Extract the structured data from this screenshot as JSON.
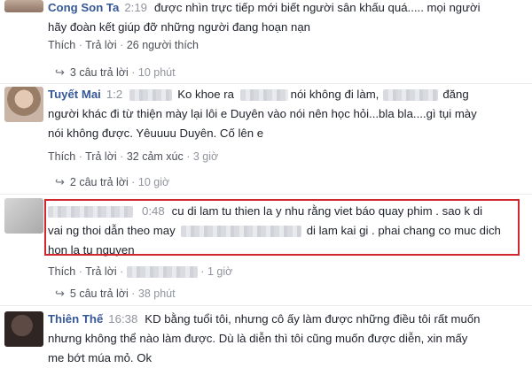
{
  "comments": [
    {
      "name": "Cong Son Ta",
      "time": "2:19",
      "text_line1": "được nhìn trực tiếp mới biết người sân khấu quá..... mọi người",
      "text_line2": "hãy đoàn kết giúp đỡ những người đang hoạn nạn",
      "action_like": "Thích",
      "action_reply": "Trả lời",
      "reaction": "26 người thích",
      "replies_count": "3 câu trả lời",
      "replies_time": "10 phút"
    },
    {
      "name": "Tuyết Mai",
      "time": "1:2",
      "text_line1a": "Ko khoe ra",
      "text_line1b": "nói không đi làm,",
      "text_line1c": "đăng",
      "text_line2": "người khác đi từ thiện mày lại lôi e Duyên vào nói nên học hỏi...bla bla....gì tụi mày",
      "text_line3": "nói không được. Yêuuuu Duyên. Cố lên e",
      "action_like": "Thích",
      "action_reply": "Trả lời",
      "reaction": "32 cảm xúc",
      "reaction_time": "3 giờ",
      "replies_count": "2 câu trả lời",
      "replies_time": "10 giờ"
    },
    {
      "time": "0:48",
      "text_line1": "cu di lam tu thien la y nhu rằng viet báo quay phim . sao k di",
      "text_line2a": "vai ng thoi dẫn theo may",
      "text_line2b": "di lam kai gi . phai chang co muc dich",
      "text_line3": "hon la tu nguyen",
      "action_like": "Thích",
      "action_reply": "Trả lời",
      "reaction_time": "1 giờ",
      "replies_count": "5 câu trả lời",
      "replies_time": "38 phút"
    },
    {
      "name": "Thiên Thế",
      "time": "16:38",
      "text_line1": "KD bằng tuổi tôi, nhưng cô ấy làm được những điều tôi rất muốn",
      "text_line2": "nhưng không thể nào làm được. Dù là diễn thì tôi cũng muốn được diễn, xin mấy",
      "text_line3": "me bớt múa mỏ. Ok"
    }
  ],
  "colors": {
    "name": "#365899",
    "highlight": "#d0282e",
    "muted": "#90949c"
  },
  "icons": {
    "reply_arrow": "reply-arrow-icon"
  }
}
